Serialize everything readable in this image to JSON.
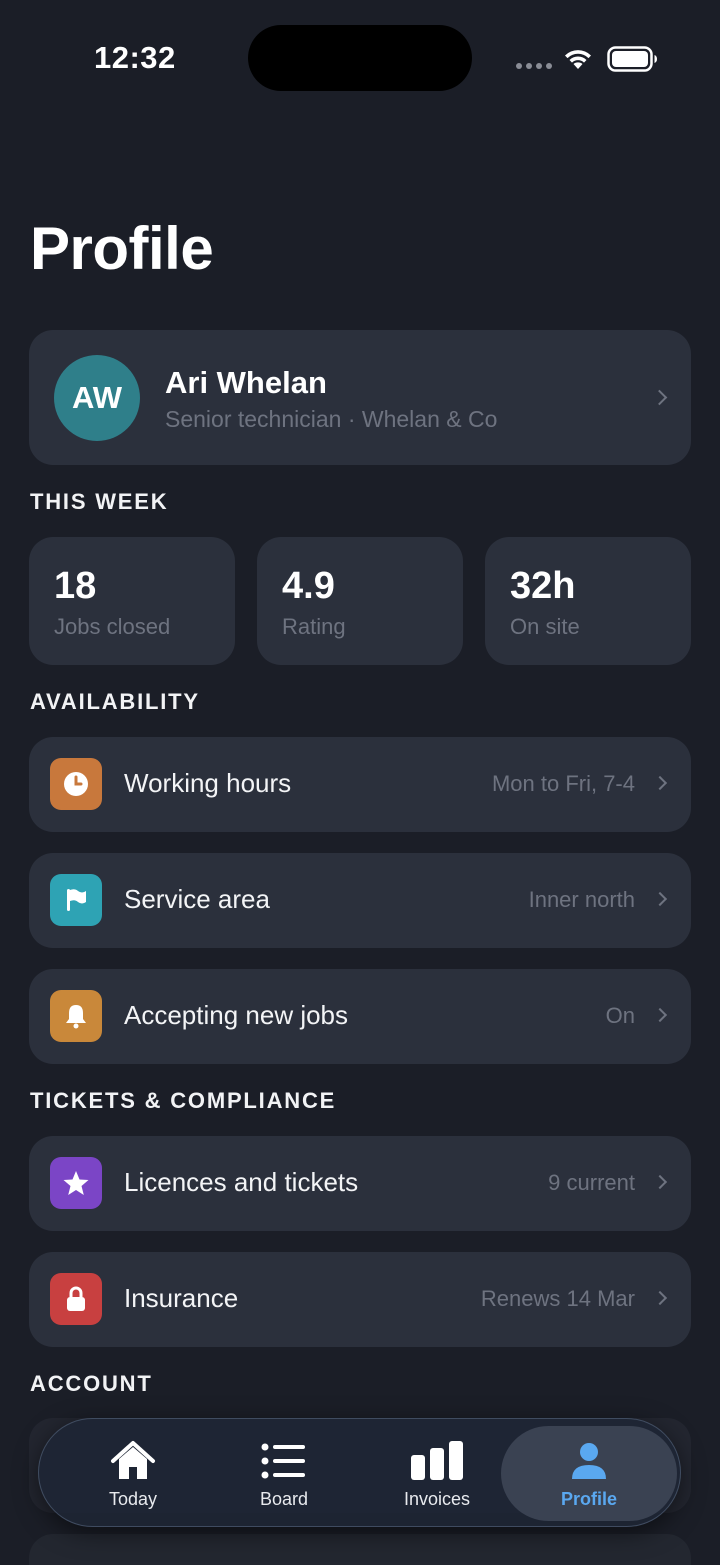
{
  "status_bar": {
    "time": "12:32"
  },
  "page": {
    "title": "Profile"
  },
  "profile": {
    "initials": "AW",
    "name": "Ari Whelan",
    "subtitle": "Senior technician · Whelan & Co"
  },
  "sections": {
    "this_week": "THIS WEEK",
    "availability": "AVAILABILITY",
    "tickets": "TICKETS & COMPLIANCE",
    "account": "ACCOUNT"
  },
  "stats": [
    {
      "value": "18",
      "label": "Jobs closed"
    },
    {
      "value": "4.9",
      "label": "Rating"
    },
    {
      "value": "32h",
      "label": "On site"
    }
  ],
  "availability": [
    {
      "label": "Working hours",
      "value": "Mon to Fri, 7-4",
      "icon": "clock-icon",
      "color": "#c8783c"
    },
    {
      "label": "Service area",
      "value": "Inner north",
      "icon": "flag-icon",
      "color": "#2ea3b4"
    },
    {
      "label": "Accepting new jobs",
      "value": "On",
      "icon": "bell-icon",
      "color": "#c9883a"
    }
  ],
  "tickets": [
    {
      "label": "Licences and tickets",
      "value": "9 current",
      "icon": "star-icon",
      "color": "#7b45c6"
    },
    {
      "label": "Insurance",
      "value": "Renews 14 Mar",
      "icon": "lock-icon",
      "color": "#c84040"
    }
  ],
  "tabs": [
    {
      "label": "Today",
      "icon": "house-icon"
    },
    {
      "label": "Board",
      "icon": "list-icon"
    },
    {
      "label": "Invoices",
      "icon": "bar-chart-icon"
    },
    {
      "label": "Profile",
      "icon": "person-icon",
      "active": true
    }
  ],
  "colors": {
    "accent": "#5aa8f0",
    "background": "#1b1e27",
    "card": "#2b303c",
    "avatar": "#2f7f8a"
  }
}
